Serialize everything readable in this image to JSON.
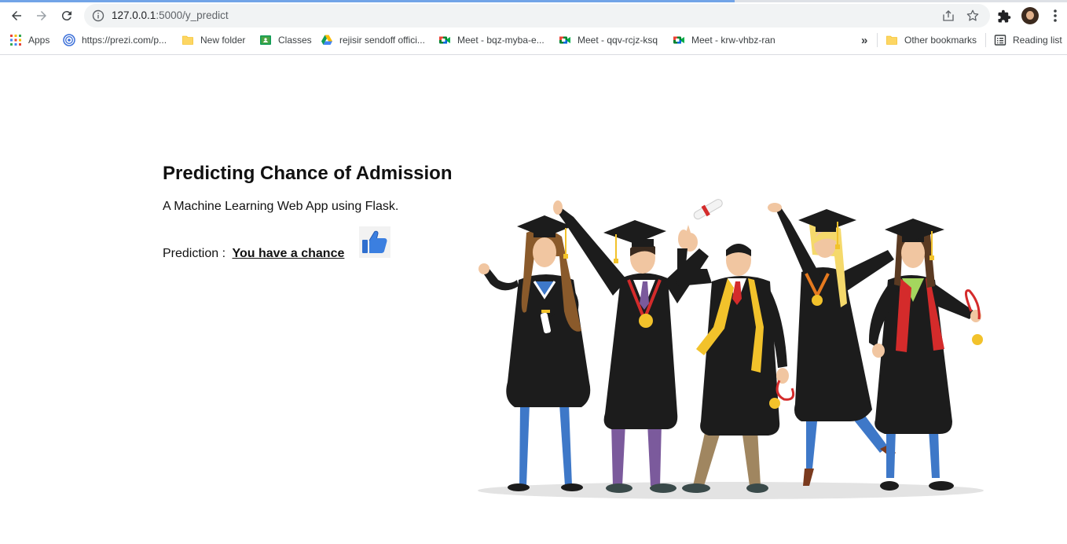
{
  "browser": {
    "url_host": "127.0.0.1",
    "url_path": ":5000/y_predict",
    "bookmarks": [
      {
        "label": "Apps",
        "icon": "apps-grid-icon"
      },
      {
        "label": "https://prezi.com/p...",
        "icon": "prezi-icon"
      },
      {
        "label": "New folder",
        "icon": "folder-icon"
      },
      {
        "label": "Classes",
        "icon": "google-classroom-icon"
      },
      {
        "label": "rejisir sendoff offici...",
        "icon": "google-drive-icon"
      },
      {
        "label": "Meet - bqz-myba-e...",
        "icon": "google-meet-icon"
      },
      {
        "label": "Meet - qqv-rcjz-ksq",
        "icon": "google-meet-icon"
      },
      {
        "label": "Meet - krw-vhbz-ran",
        "icon": "google-meet-icon"
      }
    ],
    "overflow_label": "»",
    "other_bookmarks": "Other bookmarks",
    "reading_list": "Reading list"
  },
  "page": {
    "title": "Predicting Chance of Admission",
    "subtitle": "A Machine Learning Web App using Flask.",
    "prediction_label": "Prediction :",
    "prediction_result": "You have a chance",
    "result_icon": "thumbs-up-icon",
    "illustration": "graduates-celebrating-illustration"
  },
  "colors": {
    "accent": "#1a73e8",
    "thumb_blue": "#2f6fcf",
    "gown": "#1c1c1c",
    "gold": "#f2c22b"
  }
}
